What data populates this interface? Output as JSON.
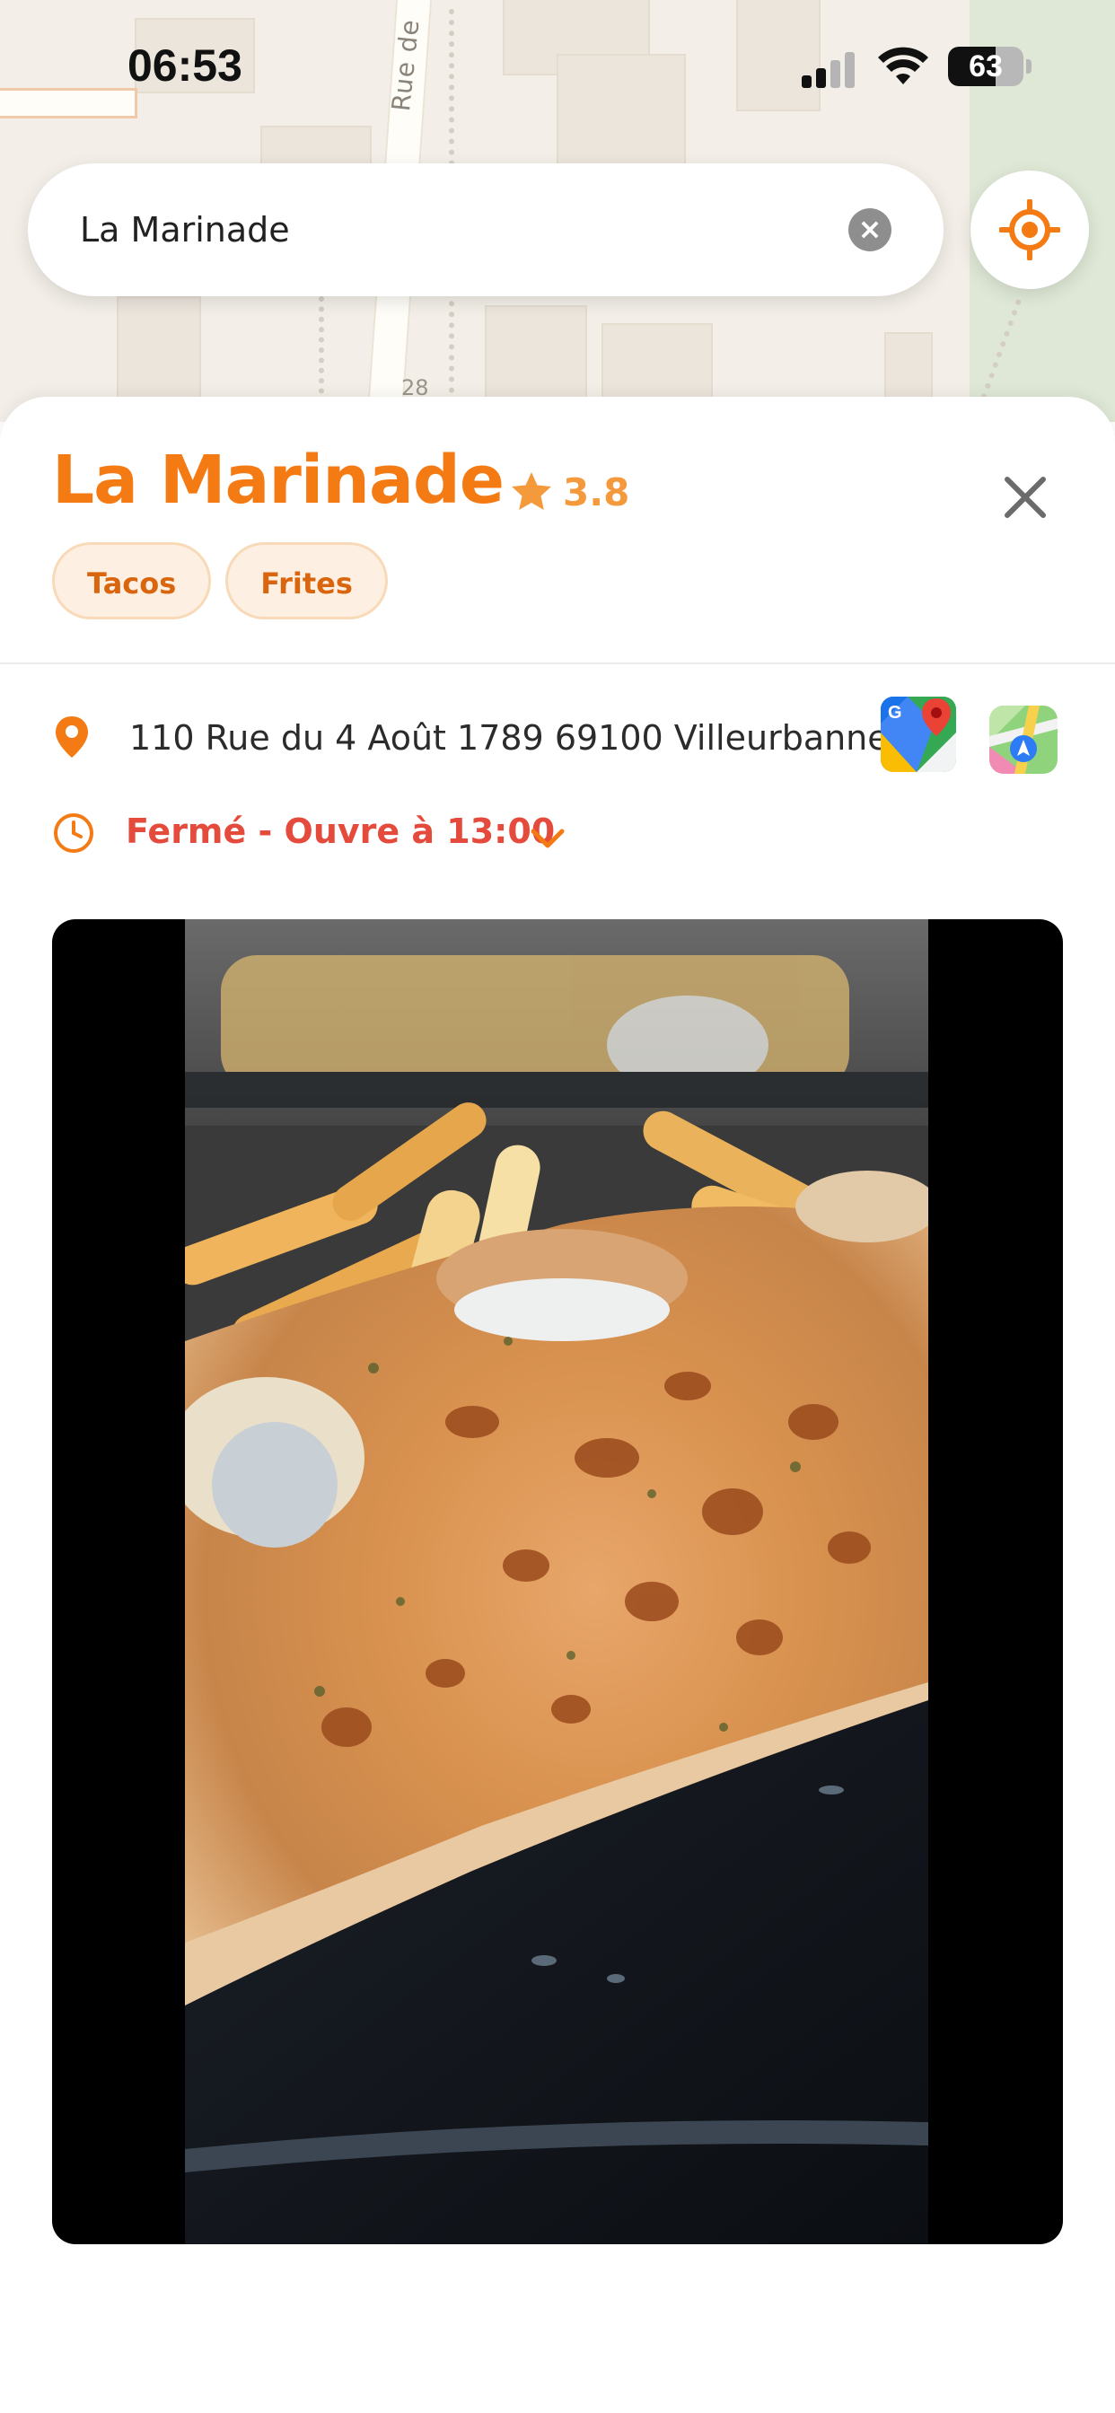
{
  "status_bar": {
    "time": "06:53",
    "battery": "63",
    "battery_level": 0.63
  },
  "search": {
    "value": "La Marinade",
    "clear_icon": "clear-icon",
    "locate_icon": "locate-icon"
  },
  "map": {
    "street_label": "Rue de",
    "house_number": "28"
  },
  "place": {
    "name": "La Marinade",
    "rating": "3.8",
    "tags": [
      "Tacos",
      "Frites"
    ],
    "address": "110 Rue du 4 Août 1789 69100 Villeurbanne",
    "hours_status": "Fermé - Ouvre à 13:00"
  },
  "colors": {
    "accent": "#f47a14",
    "rating": "#f49a3c",
    "closed": "#e54b3c",
    "chip_bg": "#fdf0e2"
  },
  "icons": {
    "close": "close-icon",
    "star": "star-icon",
    "pin": "location-pin-icon",
    "clock": "clock-icon",
    "chevron": "chevron-down-icon",
    "google_maps": "google-maps-icon",
    "apple_maps": "apple-maps-icon"
  }
}
